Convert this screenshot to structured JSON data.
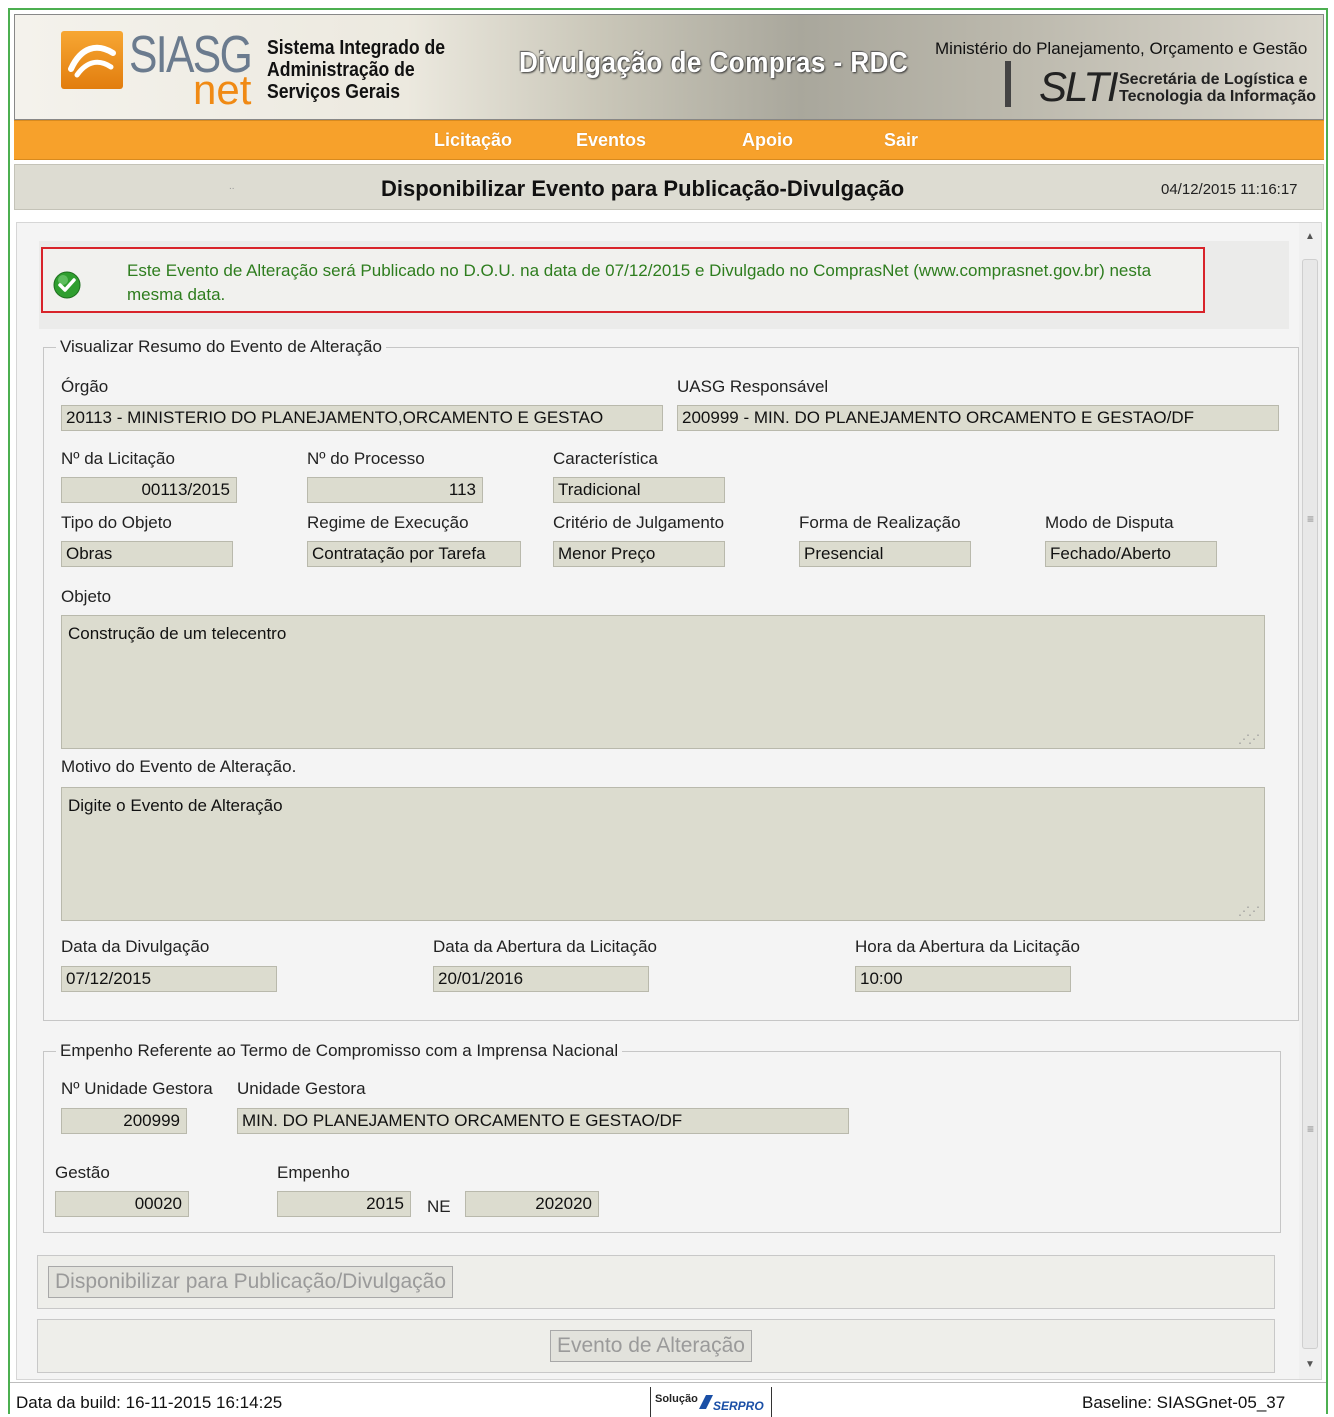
{
  "header": {
    "logo_siasg": "SIASG",
    "logo_net": "net",
    "system_name_lines": [
      "Sistema Integrado de",
      "Administração de",
      "Serviços Gerais"
    ],
    "banner_title": "Divulgação de Compras - RDC",
    "ministry": "Ministério do Planejamento, Orçamento e Gestão",
    "slti_logo": "SLTI",
    "slti_lines": [
      "Secretária de Logística e",
      "Tecnologia da Informação"
    ]
  },
  "nav": {
    "items": [
      "Licitação",
      "Eventos",
      "Apoio",
      "Sair"
    ]
  },
  "page": {
    "title": "Disponibilizar Evento para Publicação-Divulgação",
    "datetime": "04/12/2015 11:16:17",
    "dots": ".."
  },
  "notice": {
    "text": "Este Evento de Alteração será Publicado no D.O.U. na data de 07/12/2015 e Divulgado no ComprasNet (www.comprasnet.gov.br) nesta mesma data."
  },
  "summary": {
    "legend": "Visualizar Resumo do Evento de Alteração",
    "orgao_label": "Órgão",
    "orgao_value": "20113 - MINISTERIO DO PLANEJAMENTO,ORCAMENTO E GESTAO",
    "uasg_label": "UASG Responsável",
    "uasg_value": "200999 - MIN. DO PLANEJAMENTO ORCAMENTO E GESTAO/DF",
    "licitacao_label": "Nº da Licitação",
    "licitacao_value": "00113/2015",
    "processo_label": "Nº do Processo",
    "processo_value": "113",
    "caracteristica_label": "Característica",
    "caracteristica_value": "Tradicional",
    "tipo_objeto_label": "Tipo do Objeto",
    "tipo_objeto_value": "Obras",
    "regime_label": "Regime de Execução",
    "regime_value": "Contratação por Tarefa",
    "criterio_label": "Critério de Julgamento",
    "criterio_value": "Menor Preço",
    "forma_label": "Forma de Realização",
    "forma_value": "Presencial",
    "modo_label": "Modo de Disputa",
    "modo_value": "Fechado/Aberto",
    "objeto_label": "Objeto",
    "objeto_value": "Construção de um telecentro",
    "motivo_label": "Motivo do Evento de Alteração.",
    "motivo_value": "Digite o Evento de Alteração",
    "data_divulgacao_label": "Data da Divulgação",
    "data_divulgacao_value": "07/12/2015",
    "data_abertura_label": "Data da Abertura da Licitação",
    "data_abertura_value": "20/01/2016",
    "hora_abertura_label": "Hora da Abertura da Licitação",
    "hora_abertura_value": "10:00"
  },
  "empenho": {
    "legend": "Empenho Referente ao Termo de Compromisso com a Imprensa Nacional",
    "ug_num_label": "Nº Unidade Gestora",
    "ug_num_value": "200999",
    "ug_label": "Unidade Gestora",
    "ug_value": "MIN. DO PLANEJAMENTO ORCAMENTO E GESTAO/DF",
    "gestao_label": "Gestão",
    "gestao_value": "00020",
    "empenho_label": "Empenho",
    "empenho_year": "2015",
    "empenho_ne": "NE",
    "empenho_number": "202020"
  },
  "buttons": {
    "disponibilizar": "Disponibilizar para Publicação/Divulgação",
    "evento_alteracao": "Evento de Alteração"
  },
  "footer": {
    "build": "Data da build: 16-11-2015 16:14:25",
    "solucao": "Solução",
    "serpro": "SERPRO",
    "baseline": "Baseline: SIASGnet-05_37"
  },
  "colors": {
    "nav_orange": "#f7a12b",
    "notice_green": "#2e7d1e",
    "notice_border_red": "#d8232a",
    "field_bg": "#dcdccf"
  }
}
